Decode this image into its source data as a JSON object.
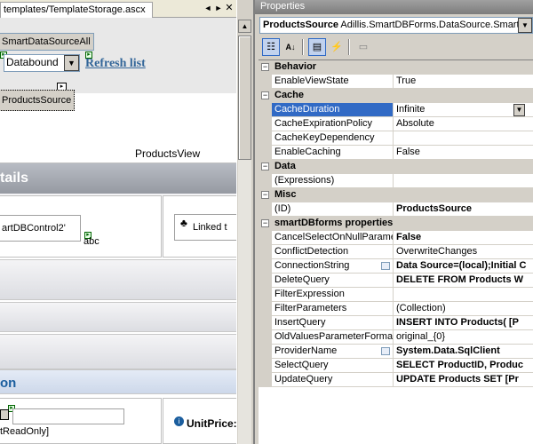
{
  "designer": {
    "tab_title": "templates/TemplateStorage.ascx",
    "datasource_label": "SmartDataSourceAll",
    "databound_value": "Databound",
    "refresh_link": "Refresh list",
    "products_source_label": "ProductsSource",
    "products_view_label": "ProductsView",
    "details_label": "tails",
    "control_label": "artDBControl2'",
    "abc_label": "abc",
    "linked_label": "Linked t",
    "section_label": "on",
    "readonly_label": "tReadOnly]",
    "unitprice_label": "UnitPrice:",
    "colors": {
      "refresh_link": "#336699",
      "section": "#1b5e9e"
    }
  },
  "properties": {
    "window_title": "Properties",
    "object_name": "ProductsSource",
    "object_type": "Adillis.SmartDBForms.DataSource.SmartD",
    "categories": [
      {
        "name": "Behavior",
        "rows": [
          {
            "name": "EnableViewState",
            "value": "True",
            "bold": false
          }
        ]
      },
      {
        "name": "Cache",
        "rows": [
          {
            "name": "CacheDuration",
            "value": "Infinite",
            "bold": false,
            "selected": true
          },
          {
            "name": "CacheExpirationPolicy",
            "value": "Absolute",
            "bold": false
          },
          {
            "name": "CacheKeyDependency",
            "value": "",
            "bold": false
          },
          {
            "name": "EnableCaching",
            "value": "False",
            "bold": false
          }
        ]
      },
      {
        "name": "Data",
        "rows": [
          {
            "name": "(Expressions)",
            "value": "",
            "bold": false
          }
        ]
      },
      {
        "name": "Misc",
        "rows": [
          {
            "name": "(ID)",
            "value": "ProductsSource",
            "bold": true
          }
        ]
      },
      {
        "name": "smartDBforms properties",
        "rows": [
          {
            "name": "CancelSelectOnNullParame",
            "value": "False",
            "bold": true
          },
          {
            "name": "ConflictDetection",
            "value": "OverwriteChanges",
            "bold": false
          },
          {
            "name": "ConnectionString",
            "value": "Data Source=(local);Initial C",
            "bold": true,
            "ellipsis": true
          },
          {
            "name": "DeleteQuery",
            "value": "DELETE FROM Products W",
            "bold": true
          },
          {
            "name": "FilterExpression",
            "value": "",
            "bold": false
          },
          {
            "name": "FilterParameters",
            "value": "(Collection)",
            "bold": false
          },
          {
            "name": "InsertQuery",
            "value": "INSERT INTO Products( [P",
            "bold": true
          },
          {
            "name": "OldValuesParameterFormatS",
            "value": "original_{0}",
            "bold": false
          },
          {
            "name": "ProviderName",
            "value": "System.Data.SqlClient",
            "bold": true,
            "ellipsis": true
          },
          {
            "name": "SelectQuery",
            "value": "SELECT ProductID, Produc",
            "bold": true
          },
          {
            "name": "UpdateQuery",
            "value": "UPDATE Products SET [Pr",
            "bold": true
          }
        ]
      }
    ]
  }
}
